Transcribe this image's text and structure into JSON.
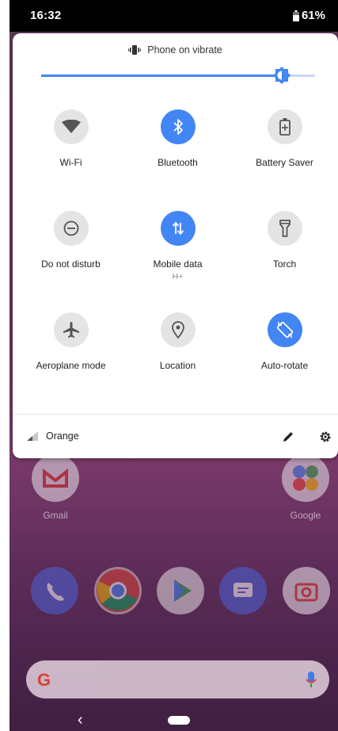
{
  "status_bar": {
    "time": "16:32",
    "battery": "61%"
  },
  "quick_settings": {
    "ringer_status": "Phone on vibrate",
    "brightness_level": 0.88,
    "tiles": [
      {
        "label": "Wi-Fi",
        "sub": "",
        "active": false,
        "icon": "wifi-icon"
      },
      {
        "label": "Bluetooth",
        "sub": "",
        "active": true,
        "icon": "bluetooth-icon"
      },
      {
        "label": "Battery Saver",
        "sub": "",
        "active": false,
        "icon": "battery-saver-icon"
      },
      {
        "label": "Do not disturb",
        "sub": "",
        "active": false,
        "icon": "do-not-disturb-icon"
      },
      {
        "label": "Mobile data",
        "sub": "H+",
        "active": true,
        "icon": "mobile-data-icon"
      },
      {
        "label": "Torch",
        "sub": "",
        "active": false,
        "icon": "torch-icon"
      },
      {
        "label": "Aeroplane mode",
        "sub": "",
        "active": false,
        "icon": "airplane-icon"
      },
      {
        "label": "Location",
        "sub": "",
        "active": false,
        "icon": "location-icon"
      },
      {
        "label": "Auto-rotate",
        "sub": "",
        "active": true,
        "icon": "auto-rotate-icon"
      }
    ],
    "carrier": "Orange"
  },
  "home_screen": {
    "apps": [
      {
        "label": "Gmail"
      },
      {
        "label": "Google"
      }
    ]
  },
  "colors": {
    "accent": "#4285f4",
    "tile_off": "#e4e4e4"
  }
}
